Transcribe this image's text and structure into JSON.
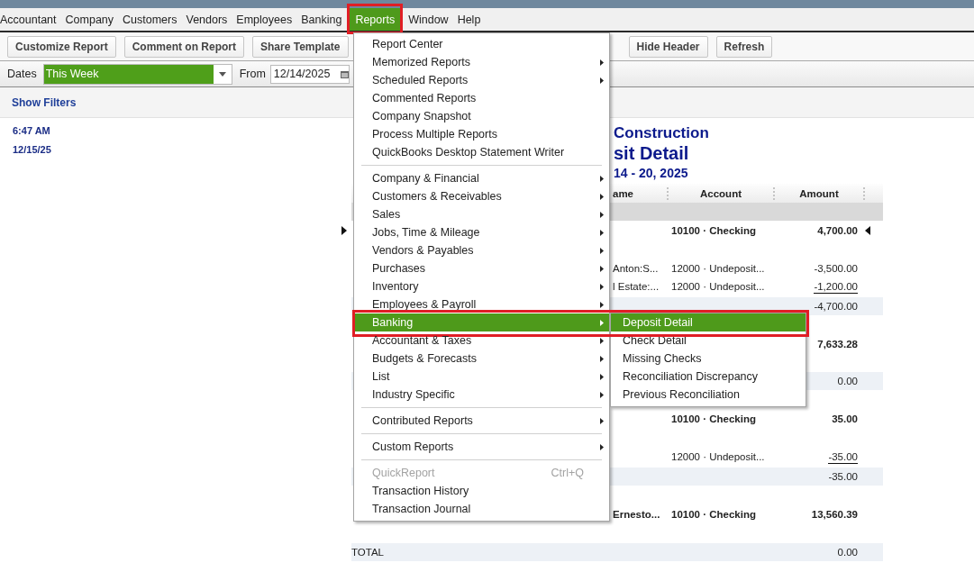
{
  "menu_bar": [
    {
      "label": "Accountant",
      "selected": false,
      "highlighted": false
    },
    {
      "label": "Company",
      "selected": false,
      "highlighted": false
    },
    {
      "label": "Customers",
      "selected": false,
      "highlighted": false
    },
    {
      "label": "Vendors",
      "selected": false,
      "highlighted": false
    },
    {
      "label": "Employees",
      "selected": false,
      "highlighted": false
    },
    {
      "label": "Banking",
      "selected": false,
      "highlighted": false
    },
    {
      "label": "Reports",
      "selected": true,
      "highlighted": true
    },
    {
      "label": "Window",
      "selected": false,
      "highlighted": false
    },
    {
      "label": "Help",
      "selected": false,
      "highlighted": false
    }
  ],
  "toolbar": {
    "buttons_left": [
      "Customize Report",
      "Comment on Report",
      "Share Template"
    ],
    "buttons_right": [
      "Hide Header",
      "Refresh"
    ]
  },
  "date_bar": {
    "dates_label": "Dates",
    "dates_value": "This Week",
    "from_label": "From",
    "from_value": "12/14/2025"
  },
  "filters": {
    "label": "Show Filters"
  },
  "report": {
    "time": "6:47 AM",
    "date": "12/15/25",
    "header_lines": [
      {
        "kind": "company",
        "text": "Construction"
      },
      {
        "kind": "title",
        "text": "sit Detail"
      },
      {
        "kind": "period",
        "text": "14 - 20, 2025"
      }
    ],
    "columns": [
      "ame",
      "Account",
      "Amount"
    ],
    "rows": [
      {
        "kind": "group",
        "selected": false
      },
      {
        "kind": "deposit",
        "selected": true,
        "account": "10100 · Checking",
        "amount": "4,700.00"
      },
      {
        "kind": "detail",
        "selected": false,
        "name": "Anton:S...",
        "account": "12000 · Undeposit...",
        "amount": "-3,500.00"
      },
      {
        "kind": "detail",
        "selected": false,
        "name": "l Estate:...",
        "account": "12000 · Undeposit...",
        "amount": "-1,200.00"
      },
      {
        "kind": "subtotal",
        "selected": false,
        "amount": "-4,700.00"
      },
      {
        "kind": "deposit",
        "selected": false,
        "amount": "7,633.28"
      },
      {
        "kind": "subtotal",
        "selected": false,
        "amount": "0.00"
      },
      {
        "kind": "deposit",
        "selected": false,
        "account": "10100 · Checking",
        "amount": "35.00"
      },
      {
        "kind": "detail",
        "selected": false,
        "account": "12000 · Undeposit...",
        "amount": "-35.00"
      },
      {
        "kind": "subtotal",
        "selected": false,
        "amount": "-35.00"
      },
      {
        "kind": "deposit",
        "selected": false,
        "name": "Ernesto...",
        "account": "10100 · Checking",
        "amount": "13,560.39"
      },
      {
        "kind": "total",
        "selected": false,
        "label": "TOTAL",
        "amount": "0.00"
      }
    ]
  },
  "reports_menu": {
    "groups": [
      [
        {
          "label": "Report Center",
          "submenu": false,
          "disabled": false,
          "selected": false,
          "highlighted": false
        },
        {
          "label": "Memorized Reports",
          "submenu": true,
          "disabled": false,
          "selected": false,
          "highlighted": false
        },
        {
          "label": "Scheduled Reports",
          "submenu": true,
          "disabled": false,
          "selected": false,
          "highlighted": false
        },
        {
          "label": "Commented Reports",
          "submenu": false,
          "disabled": false,
          "selected": false,
          "highlighted": false
        },
        {
          "label": "Company Snapshot",
          "submenu": false,
          "disabled": false,
          "selected": false,
          "highlighted": false
        },
        {
          "label": "Process Multiple Reports",
          "submenu": false,
          "disabled": false,
          "selected": false,
          "highlighted": false
        },
        {
          "label": "QuickBooks Desktop Statement Writer",
          "submenu": false,
          "disabled": false,
          "selected": false,
          "highlighted": false
        }
      ],
      [
        {
          "label": "Company & Financial",
          "submenu": true,
          "disabled": false,
          "selected": false,
          "highlighted": false
        },
        {
          "label": "Customers & Receivables",
          "submenu": true,
          "disabled": false,
          "selected": false,
          "highlighted": false
        },
        {
          "label": "Sales",
          "submenu": true,
          "disabled": false,
          "selected": false,
          "highlighted": false
        },
        {
          "label": "Jobs, Time & Mileage",
          "submenu": true,
          "disabled": false,
          "selected": false,
          "highlighted": false
        },
        {
          "label": "Vendors & Payables",
          "submenu": true,
          "disabled": false,
          "selected": false,
          "highlighted": false
        },
        {
          "label": "Purchases",
          "submenu": true,
          "disabled": false,
          "selected": false,
          "highlighted": false
        },
        {
          "label": "Inventory",
          "submenu": true,
          "disabled": false,
          "selected": false,
          "highlighted": false
        },
        {
          "label": "Employees & Payroll",
          "submenu": true,
          "disabled": false,
          "selected": false,
          "highlighted": false
        },
        {
          "label": "Banking",
          "submenu": true,
          "disabled": false,
          "selected": true,
          "highlighted": true
        },
        {
          "label": "Accountant & Taxes",
          "submenu": true,
          "disabled": false,
          "selected": false,
          "highlighted": false
        },
        {
          "label": "Budgets & Forecasts",
          "submenu": true,
          "disabled": false,
          "selected": false,
          "highlighted": false
        },
        {
          "label": "List",
          "submenu": true,
          "disabled": false,
          "selected": false,
          "highlighted": false
        },
        {
          "label": "Industry Specific",
          "submenu": true,
          "disabled": false,
          "selected": false,
          "highlighted": false
        }
      ],
      [
        {
          "label": "Contributed Reports",
          "submenu": true,
          "disabled": false,
          "selected": false,
          "highlighted": false
        }
      ],
      [
        {
          "label": "Custom Reports",
          "submenu": true,
          "disabled": false,
          "selected": false,
          "highlighted": false
        }
      ],
      [
        {
          "label": "QuickReport",
          "submenu": false,
          "disabled": true,
          "selected": false,
          "highlighted": false,
          "shortcut": "Ctrl+Q"
        },
        {
          "label": "Transaction History",
          "submenu": false,
          "disabled": false,
          "selected": false,
          "highlighted": false
        },
        {
          "label": "Transaction Journal",
          "submenu": false,
          "disabled": false,
          "selected": false,
          "highlighted": false
        }
      ]
    ]
  },
  "banking_submenu": [
    {
      "label": "Deposit Detail",
      "selected": true
    },
    {
      "label": "Check Detail",
      "selected": false
    },
    {
      "label": "Missing Checks",
      "selected": false
    },
    {
      "label": "Reconciliation Discrepancy",
      "selected": false
    },
    {
      "label": "Previous Reconciliation",
      "selected": false
    }
  ]
}
